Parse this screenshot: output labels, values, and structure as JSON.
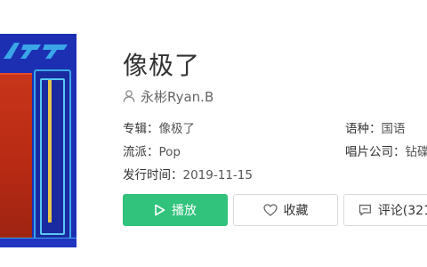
{
  "song": {
    "title": "像极了",
    "artist": "永彬Ryan.B"
  },
  "meta": {
    "album_key": "专辑：",
    "album_value": "像极了",
    "genre_key": "流派：",
    "genre_value": "Pop",
    "release_key": "发行时间：",
    "release_value": "2019-11-15",
    "language_key": "语种：",
    "language_value": "国语",
    "label_key": "唱片公司：",
    "label_value": "钻碟"
  },
  "actions": {
    "play_label": "播放",
    "favorite_label": "收藏",
    "comment_label": "评论(321"
  },
  "colors": {
    "accent_green": "#31c27c",
    "cover_blue": "#1c2fb3",
    "cover_red": "#c7351a"
  },
  "icons": {
    "artist": "user-icon",
    "play": "play-icon",
    "favorite": "heart-icon",
    "comment": "comment-icon"
  }
}
